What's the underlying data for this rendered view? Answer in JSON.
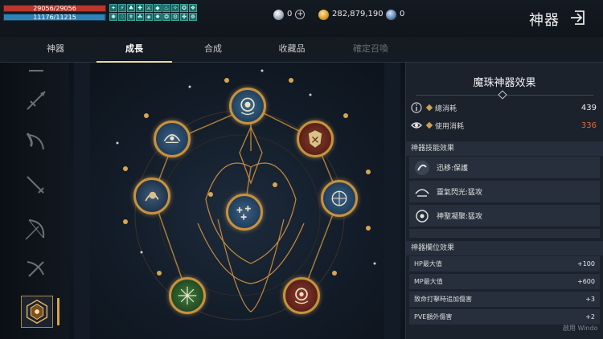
{
  "player": {
    "hp_text": "29056/29056",
    "mp_text": "11176/11215",
    "hp_ratio": 1.0,
    "mp_ratio": 0.9967
  },
  "buffs": [
    "✦",
    "⚡",
    "♣",
    "✚",
    "⚔",
    "◆",
    "♨",
    "✧",
    "✪",
    "❖",
    "✺",
    "♢",
    "⚜",
    "☘",
    "◈",
    "✸",
    "❂",
    "⚙",
    "✤",
    "☸"
  ],
  "currency": {
    "diamond": "0",
    "gold": "282,879,190",
    "orb": "0"
  },
  "header": {
    "title": "神器"
  },
  "tabs": [
    {
      "label": "神器",
      "state": "normal"
    },
    {
      "label": "成長",
      "state": "active"
    },
    {
      "label": "合成",
      "state": "normal"
    },
    {
      "label": "收藏品",
      "state": "normal"
    },
    {
      "label": "確定召喚",
      "state": "disabled"
    }
  ],
  "sidebar_icons": [
    "axe-icon",
    "spear-icon",
    "scythe-icon",
    "sword-icon",
    "bow-icon",
    "crossbow-icon",
    "artifact-orb-icon"
  ],
  "right_panel": {
    "title": "魔珠神器效果",
    "total_label": "總消耗",
    "total_value": "439",
    "used_label": "使用消耗",
    "used_value": "336",
    "skills_header": "神器技能效果",
    "skills": [
      {
        "name": "迅移:保護",
        "icon": "swift-move-icon"
      },
      {
        "name": "靈氣閃光:猛攻",
        "icon": "aura-flash-icon"
      },
      {
        "name": "神聖凝聚:猛攻",
        "icon": "holy-gather-icon"
      }
    ],
    "slots_header": "神器欄位效果",
    "slots": [
      {
        "label": "HP最大值",
        "value": "+100"
      },
      {
        "label": "MP最大值",
        "value": "+600"
      },
      {
        "label": "致命打擊時追加傷害",
        "value": "+3"
      },
      {
        "label": "PVE額外傷害",
        "value": "+2"
      }
    ]
  },
  "watermark": "啟用 Windo",
  "colors": {
    "accent_gold": "#c8923e",
    "hp": "#b8362c",
    "mp": "#2f82b8",
    "warn": "#e26a3a"
  }
}
